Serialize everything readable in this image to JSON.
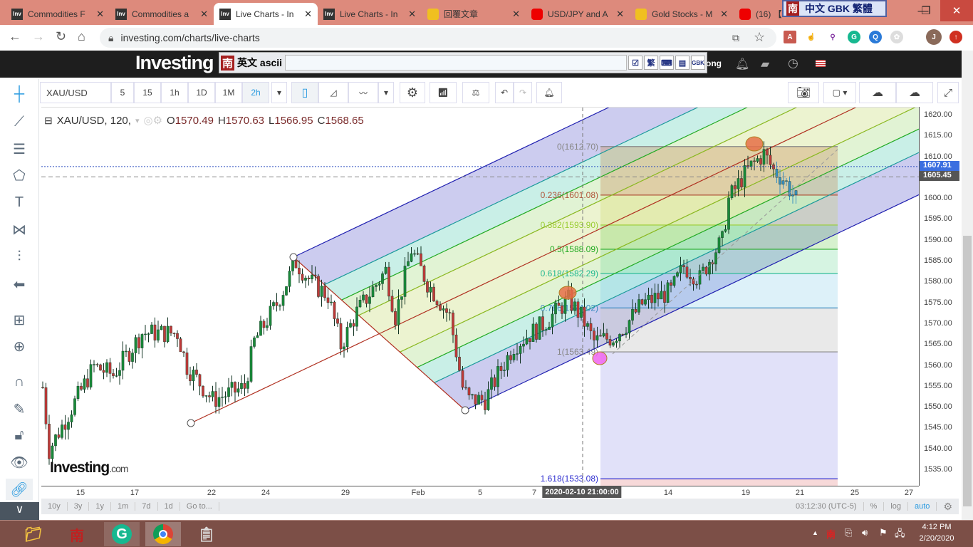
{
  "browser": {
    "tabs": [
      {
        "title": "Commodities F",
        "icon": "investing-favicon"
      },
      {
        "title": "Commodities a",
        "icon": "investing-favicon"
      },
      {
        "title": "Live Charts - In",
        "icon": "investing-favicon",
        "active": true
      },
      {
        "title": "Live Charts - In",
        "icon": "investing-favicon"
      },
      {
        "title": "回覆文章",
        "icon": "gem-favicon"
      },
      {
        "title": "USD/JPY and A",
        "icon": "youtube-favicon"
      },
      {
        "title": "Gold Stocks - M",
        "icon": "gold-favicon"
      },
      {
        "title": "(16) 【",
        "icon": "youtube-favicon"
      }
    ],
    "close_glyph": "✕",
    "url": "investing.com/charts/live-charts",
    "profile_initial": "J"
  },
  "ime": {
    "top_label": "中文 GBK 繁體",
    "nan": "南",
    "bar_label": "英文 ascii",
    "trad": "繁",
    "gbk": "GBK"
  },
  "site": {
    "logo": "Investing",
    "header_partial": "ong"
  },
  "toolbar": {
    "symbol": "XAU/USD",
    "intervals": [
      "5",
      "15",
      "1h",
      "1D",
      "1M",
      "2h"
    ],
    "active_interval": "2h"
  },
  "legend": {
    "title": "XAU/USD, 120,",
    "o_label": "O",
    "o": "1570.49",
    "h_label": "H",
    "h": "1570.63",
    "l_label": "L",
    "l": "1566.95",
    "c_label": "C",
    "c": "1568.65"
  },
  "chart_data": {
    "type": "candlestick",
    "symbol": "XAU/USD",
    "interval_minutes": 120,
    "ylim": [
      1530,
      1622
    ],
    "y_ticks": [
      "1620.00",
      "1615.00",
      "1610.00",
      "1605.00",
      "1600.00",
      "1595.00",
      "1590.00",
      "1585.00",
      "1580.00",
      "1575.00",
      "1570.00",
      "1565.00",
      "1560.00",
      "1555.00",
      "1550.00",
      "1545.00",
      "1540.00",
      "1535.00"
    ],
    "x_ticks": [
      "15",
      "17",
      "22",
      "24",
      "29",
      "Feb",
      "5",
      "7",
      "14",
      "19",
      "21",
      "25",
      "27"
    ],
    "crosshair_time": "2020-02-10 21:00:00",
    "last_price": "1607.91",
    "crosshair_price": "1605.45",
    "price_path": [
      [
        0,
        1555
      ],
      [
        2,
        1540
      ],
      [
        9,
        1550
      ],
      [
        16,
        1560
      ],
      [
        22,
        1558
      ],
      [
        31,
        1568
      ],
      [
        42,
        1568
      ],
      [
        45,
        1560
      ],
      [
        53,
        1552
      ],
      [
        63,
        1555
      ],
      [
        66,
        1566
      ],
      [
        73,
        1575
      ],
      [
        79,
        1585
      ],
      [
        84,
        1580
      ],
      [
        89,
        1577
      ],
      [
        93,
        1565
      ],
      [
        98,
        1573
      ],
      [
        107,
        1583
      ],
      [
        110,
        1572
      ],
      [
        115,
        1588
      ],
      [
        120,
        1580
      ],
      [
        127,
        1572
      ],
      [
        131,
        1555
      ],
      [
        133,
        1552
      ],
      [
        138,
        1552
      ],
      [
        142,
        1558
      ],
      [
        147,
        1565
      ],
      [
        156,
        1570
      ],
      [
        164,
        1576
      ],
      [
        168,
        1572
      ],
      [
        172,
        1566
      ],
      [
        178,
        1567
      ],
      [
        182,
        1570
      ],
      [
        187,
        1575
      ],
      [
        196,
        1578
      ],
      [
        200,
        1584
      ],
      [
        205,
        1581
      ],
      [
        209,
        1587
      ],
      [
        212,
        1590
      ],
      [
        214,
        1600
      ],
      [
        218,
        1605
      ],
      [
        221,
        1608
      ],
      [
        225,
        1611
      ],
      [
        228,
        1607
      ],
      [
        231,
        1605
      ],
      [
        235,
        1600
      ]
    ],
    "fibonacci": [
      {
        "label": "0(1612.70)",
        "price": 1612.7,
        "color": "#888888"
      },
      {
        "label": "0.236(1601.08)",
        "price": 1601.08,
        "color": "#b0553a"
      },
      {
        "label": "0.382(1593.90)",
        "price": 1593.9,
        "color": "#9acd32"
      },
      {
        "label": "0.5(1588.09)",
        "price": 1588.09,
        "color": "#22aa22"
      },
      {
        "label": "0.618(1582.29)",
        "price": 1582.29,
        "color": "#20b890"
      },
      {
        "label": "0.786(1574.02)",
        "price": 1574.02,
        "color": "#3a8ac0"
      },
      {
        "label": "1(1563.49)",
        "price": 1563.49,
        "color": "#888888"
      },
      {
        "label": "1.618(1533.08)",
        "price": 1533.08,
        "color": "#3030d0"
      }
    ],
    "watermark": "Investing.com"
  },
  "bottom": {
    "ranges": [
      "10y",
      "3y",
      "1y",
      "1m",
      "7d",
      "1d",
      "Go to..."
    ],
    "clock": "03:12:30 (UTC-5)",
    "pct": "%",
    "log": "log",
    "auto": "auto"
  },
  "taskbar": {
    "time": "4:12 PM",
    "date": "2/20/2020"
  }
}
